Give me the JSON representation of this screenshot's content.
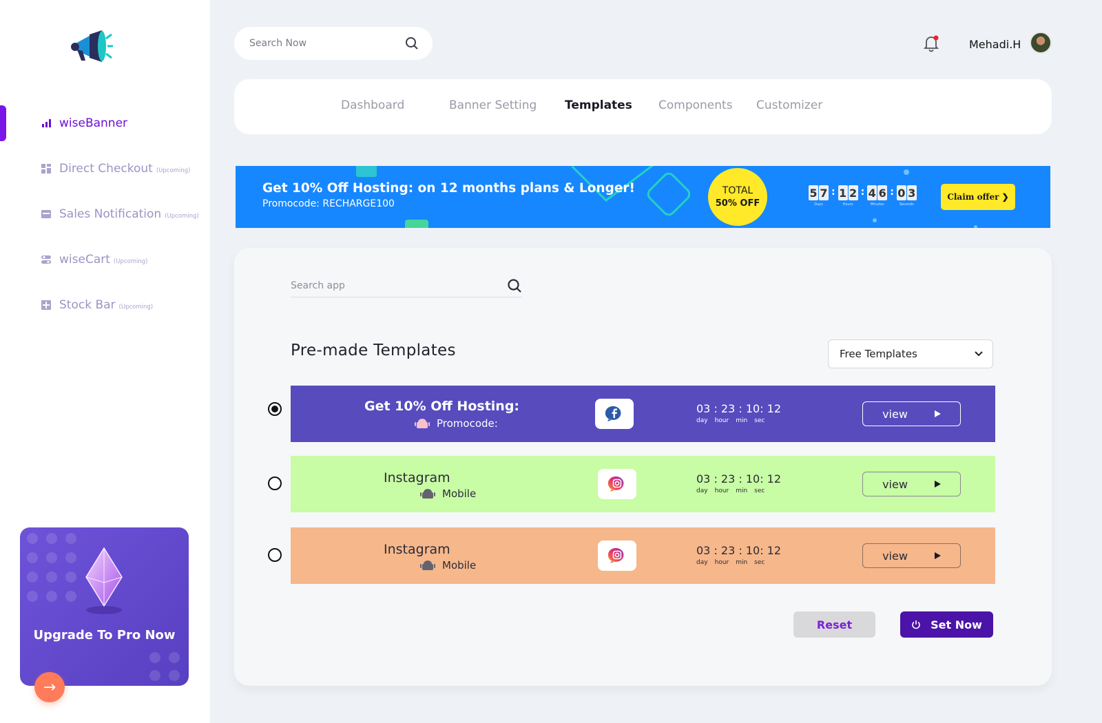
{
  "brand": {
    "logo_icon": "megaphone-icon"
  },
  "sidebar": {
    "items": [
      {
        "label": "wiseBanner",
        "tag": "",
        "icon": "bar-chart-icon",
        "active": true
      },
      {
        "label": "Direct Checkout",
        "tag": "(Upcoming)",
        "icon": "grid-icon",
        "active": false
      },
      {
        "label": "Sales Notification",
        "tag": "(Upcoming)",
        "icon": "card-icon",
        "active": false
      },
      {
        "label": "wiseCart",
        "tag": "(Upcoming)",
        "icon": "toggle-icon",
        "active": false
      },
      {
        "label": "Stock Bar",
        "tag": "(Upcoming)",
        "icon": "box-icon",
        "active": false
      }
    ],
    "upgrade": {
      "title": "Upgrade To Pro Now",
      "arrow": "→"
    }
  },
  "header": {
    "search_placeholder": "Search Now",
    "username": "Mehadi.H",
    "notification_dot": true
  },
  "tabs": [
    {
      "label": "Dashboard",
      "active": false
    },
    {
      "label": "Banner Setting",
      "active": false
    },
    {
      "label": "Templates",
      "active": true
    },
    {
      "label": "Components",
      "active": false
    },
    {
      "label": "Customizer",
      "active": false
    }
  ],
  "promo": {
    "title": "Get 10% Off Hosting: on 12 months plans & Longer!",
    "code": "Promocode: RECHARGE100",
    "badge_top": "TOTAL",
    "badge_bottom": "50% OFF",
    "countdown": [
      {
        "digits": [
          "5",
          "7"
        ],
        "unit": "Days"
      },
      {
        "digits": [
          "1",
          "2"
        ],
        "unit": "Hours"
      },
      {
        "digits": [
          "4",
          "6"
        ],
        "unit": "Minutes"
      },
      {
        "digits": [
          "0",
          "3"
        ],
        "unit": "Seconds"
      }
    ],
    "claim_label": "Claim offer ❯",
    "colors": {
      "bg": "#1787ff",
      "badge": "#ffe928"
    }
  },
  "main": {
    "search_placeholder": "Search app",
    "section_title": "Pre-made Templates",
    "filter_selected": "Free Templates",
    "templates": [
      {
        "title": "Get 10% Off Hosting:",
        "subtitle": "Promocode:",
        "app_icon": "facebook-icon",
        "timer": "03 : 23 : 10: 12",
        "units": [
          "day",
          "hour",
          "min",
          "sec"
        ],
        "view_label": "view",
        "selected": true,
        "bg": "#574bbd",
        "text_color": "#ffffff"
      },
      {
        "title": "Instagram",
        "subtitle": "Mobile",
        "app_icon": "instagram-icon",
        "timer": "03 : 23 : 10: 12",
        "units": [
          "day",
          "hour",
          "min",
          "sec"
        ],
        "view_label": "view",
        "selected": false,
        "bg": "#c8fca5",
        "text_color": "#2b2b36"
      },
      {
        "title": "Instagram",
        "subtitle": "Mobile",
        "app_icon": "instagram-icon",
        "timer": "03 : 23 : 10: 12",
        "units": [
          "day",
          "hour",
          "min",
          "sec"
        ],
        "view_label": "view",
        "selected": false,
        "bg": "#f6b78b",
        "text_color": "#2b2b36"
      }
    ],
    "reset_label": "Reset",
    "setnow_label": "Set Now"
  }
}
